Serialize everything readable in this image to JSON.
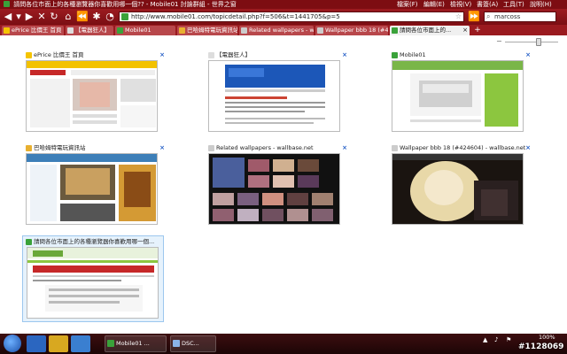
{
  "window": {
    "title": "請問各位市面上的各種瀏覽器你喜歡用哪一個?? - Mobile01 討論群組 - 世界之窗"
  },
  "menu": [
    "檔案(F)",
    "編輯(E)",
    "檢視(V)",
    "書簽(A)",
    "工具(T)",
    "說明(H)"
  ],
  "address": {
    "url": "http://www.mobile01.com/topicdetail.php?f=506&t=1441705&p=5"
  },
  "search": {
    "value": "marcoss"
  },
  "tabs": [
    {
      "label": "ePrice 比價王 首頁"
    },
    {
      "label": "【電器狂人】"
    },
    {
      "label": "Mobile01"
    },
    {
      "label": "巴哈姆特電玩資訊站"
    },
    {
      "label": "Related wallpapers - w..."
    },
    {
      "label": "Wallpaper bbb 18 (#4..."
    },
    {
      "label": "請問各位市面上的..."
    }
  ],
  "thumbnails": [
    {
      "title": "ePrice 比價王 首頁"
    },
    {
      "title": "【電器狂人】"
    },
    {
      "title": "Mobile01"
    },
    {
      "title": "巴哈姆特電玩資訊站"
    },
    {
      "title": "Related wallpapers - wallbase.net"
    },
    {
      "title": "Wallpaper bbb 18 (#424604) - wallbase.net"
    },
    {
      "title": "請問各位市面上的各種瀏覽器你喜歡用哪一個..."
    }
  ],
  "taskbar": {
    "apps": [
      {
        "label": "Mobile01 ..."
      },
      {
        "label": "DSC..."
      }
    ],
    "zoom": "100%",
    "watermark": "#1128069"
  },
  "colors": {
    "chrome": "#8b1318",
    "accent": "#2a62c8"
  }
}
